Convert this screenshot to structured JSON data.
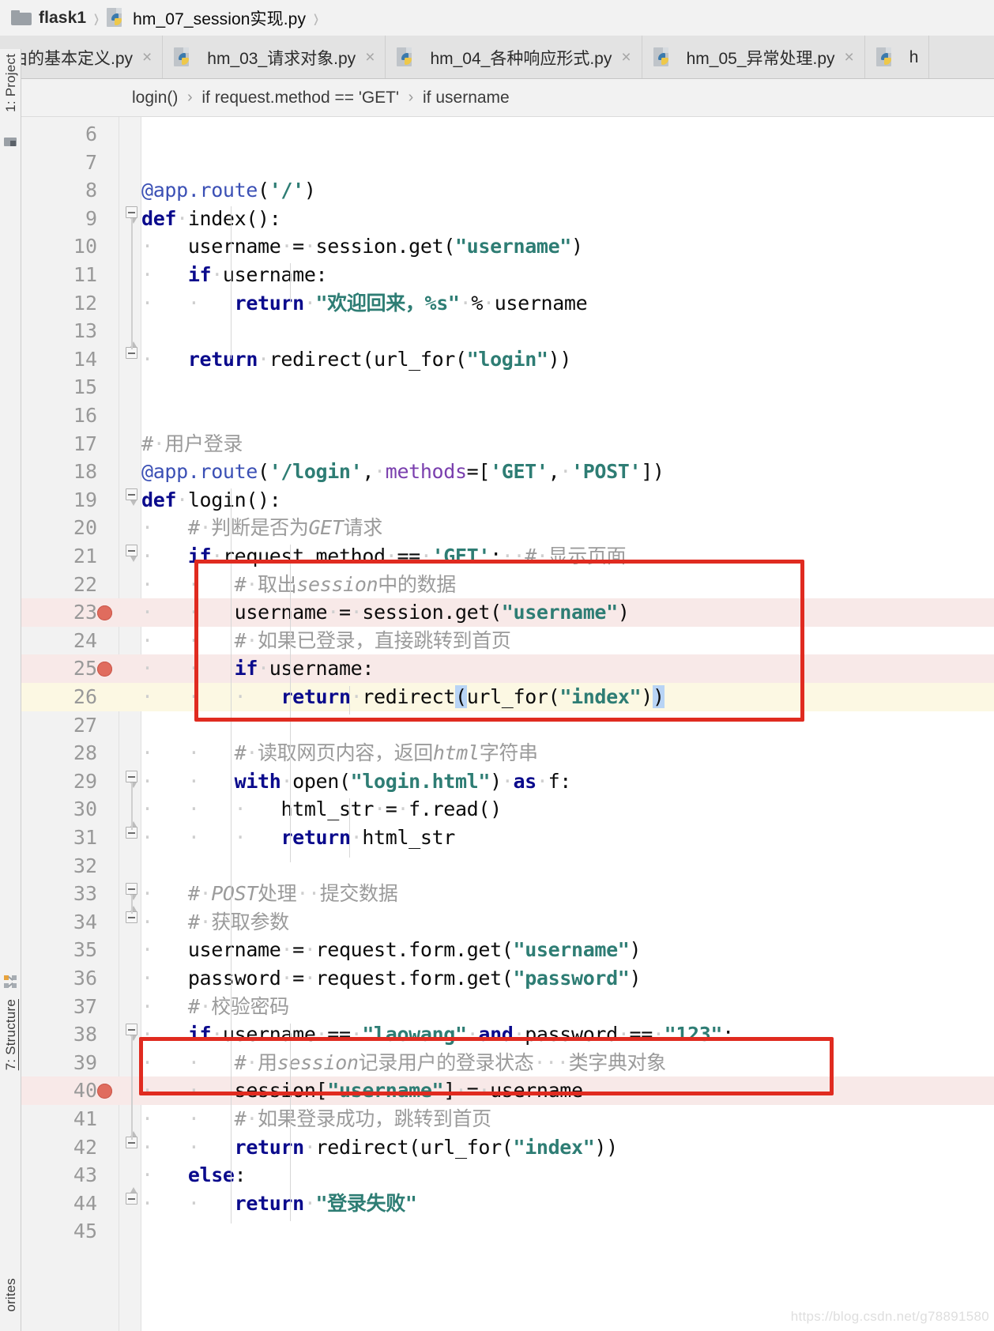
{
  "breadcrumb": {
    "project": "flask1",
    "file": "hm_07_session实现.py",
    "folder_icon": "folder-icon",
    "file_icon": "python-file-icon",
    "separator": "›"
  },
  "tabs": [
    {
      "label": "由的基本定义.py",
      "close": "×",
      "icon": "python-file-icon",
      "active": false,
      "truncated": true
    },
    {
      "label": "hm_03_请求对象.py",
      "close": "×",
      "icon": "python-file-icon",
      "active": false
    },
    {
      "label": "hm_04_各种响应形式.py",
      "close": "×",
      "icon": "python-file-icon",
      "active": false
    },
    {
      "label": "hm_05_异常处理.py",
      "close": "×",
      "icon": "python-file-icon",
      "active": false
    },
    {
      "label": "h",
      "close": "",
      "icon": "python-file-icon",
      "active": false,
      "truncated": true
    }
  ],
  "code_breadcrumb": {
    "items": [
      "login()",
      "if request.method == 'GET'",
      "if username"
    ],
    "separator": "›"
  },
  "tool_windows": {
    "project": "1: Project",
    "structure": "7: Structure",
    "favorites": "orites"
  },
  "watermark": "https://blog.csdn.net/g78891580",
  "colors": {
    "keyword": "#0a0a8c",
    "string": "#2e7d74",
    "comment": "#9b9b9b",
    "decorator": "#3b50b5",
    "named_arg": "#7a3fae",
    "annotation_box": "#e02b20",
    "breakpoint": "#e06c5e",
    "caret_line": "#fcf8e3",
    "breakpoint_line": "#f8e9e8",
    "brace_match": "#b8d4f5"
  },
  "editor": {
    "first_line": 6,
    "lines": [
      {
        "n": 6,
        "text": ""
      },
      {
        "n": 7,
        "text": ""
      },
      {
        "n": 8,
        "text": "@app.route('/')"
      },
      {
        "n": 9,
        "text": "def index():"
      },
      {
        "n": 10,
        "text": "    username = session.get(\"username\")"
      },
      {
        "n": 11,
        "text": "    if username:"
      },
      {
        "n": 12,
        "text": "        return \"欢迎回来，%s\" % username"
      },
      {
        "n": 13,
        "text": ""
      },
      {
        "n": 14,
        "text": "    return redirect(url_for(\"login\"))"
      },
      {
        "n": 15,
        "text": ""
      },
      {
        "n": 16,
        "text": ""
      },
      {
        "n": 17,
        "text": "# 用户登录"
      },
      {
        "n": 18,
        "text": "@app.route('/login', methods=['GET', 'POST'])"
      },
      {
        "n": 19,
        "text": "def login():"
      },
      {
        "n": 20,
        "text": "    # 判断是否为GET请求"
      },
      {
        "n": 21,
        "text": "    if request.method == 'GET':  # 显示页面"
      },
      {
        "n": 22,
        "text": "        # 取出session中的数据"
      },
      {
        "n": 23,
        "text": "        username = session.get(\"username\")",
        "breakpoint": true
      },
      {
        "n": 24,
        "text": "        # 如果已登录，直接跳转到首页"
      },
      {
        "n": 25,
        "text": "        if username:",
        "breakpoint": true
      },
      {
        "n": 26,
        "text": "            return redirect(url_for(\"index\"))",
        "caret": true
      },
      {
        "n": 27,
        "text": ""
      },
      {
        "n": 28,
        "text": "        # 读取网页内容，返回html字符串"
      },
      {
        "n": 29,
        "text": "        with open(\"login.html\") as f:"
      },
      {
        "n": 30,
        "text": "            html_str = f.read()"
      },
      {
        "n": 31,
        "text": "            return html_str"
      },
      {
        "n": 32,
        "text": ""
      },
      {
        "n": 33,
        "text": "    # POST处理  提交数据"
      },
      {
        "n": 34,
        "text": "    # 获取参数"
      },
      {
        "n": 35,
        "text": "    username = request.form.get(\"username\")"
      },
      {
        "n": 36,
        "text": "    password = request.form.get(\"password\")"
      },
      {
        "n": 37,
        "text": "    # 校验密码"
      },
      {
        "n": 38,
        "text": "    if username == \"laowang\" and password == \"123\":"
      },
      {
        "n": 39,
        "text": "        # 用session记录用户的登录状态   类字典对象"
      },
      {
        "n": 40,
        "text": "        session[\"username\"] = username",
        "breakpoint": true
      },
      {
        "n": 41,
        "text": "        # 如果登录成功，跳转到首页"
      },
      {
        "n": 42,
        "text": "        return redirect(url_for(\"index\"))"
      },
      {
        "n": 43,
        "text": "    else:"
      },
      {
        "n": 44,
        "text": "        return \"登录失败\""
      },
      {
        "n": 45,
        "text": ""
      }
    ]
  }
}
